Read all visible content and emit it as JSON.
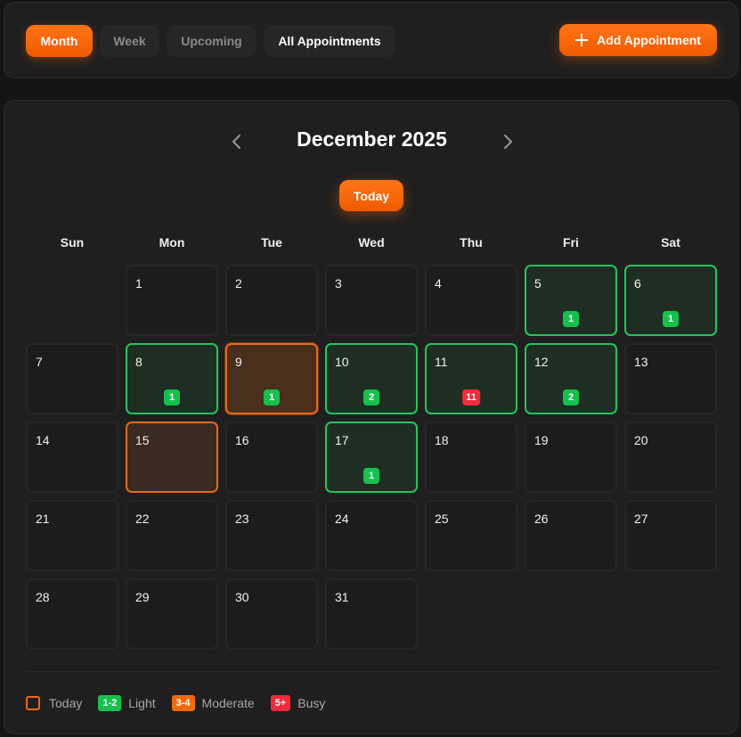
{
  "toolbar": {
    "tabs": [
      {
        "label": "Month",
        "active": true
      },
      {
        "label": "Week",
        "active": false
      },
      {
        "label": "Upcoming",
        "active": false
      },
      {
        "label": "All Appointments",
        "active": false
      }
    ],
    "add_button_label": "Add Appointment",
    "add_button_icon": "plus-icon"
  },
  "calendar": {
    "title": "December 2025",
    "prev_icon": "chevron-left-icon",
    "next_icon": "chevron-right-icon",
    "today_label": "Today",
    "weekdays": [
      "Sun",
      "Mon",
      "Tue",
      "Wed",
      "Thu",
      "Fri",
      "Sat"
    ],
    "first_weekday_index": 1,
    "days_in_month": 31,
    "today_date": 15,
    "selected_date": 9,
    "appointments": {
      "5": "1",
      "6": "1",
      "8": "1",
      "9": "1",
      "10": "2",
      "11": "11",
      "12": "2",
      "17": "1"
    }
  },
  "legend": {
    "today": "Today",
    "light_chip": "1-2",
    "light": "Light",
    "moderate_chip": "3-4",
    "moderate": "Moderate",
    "busy_chip": "5+",
    "busy": "Busy"
  },
  "colors": {
    "accent": "#ff6a00",
    "light": "#22c55e",
    "busy": "#ef2b3c",
    "moderate": "#f26a0c"
  }
}
